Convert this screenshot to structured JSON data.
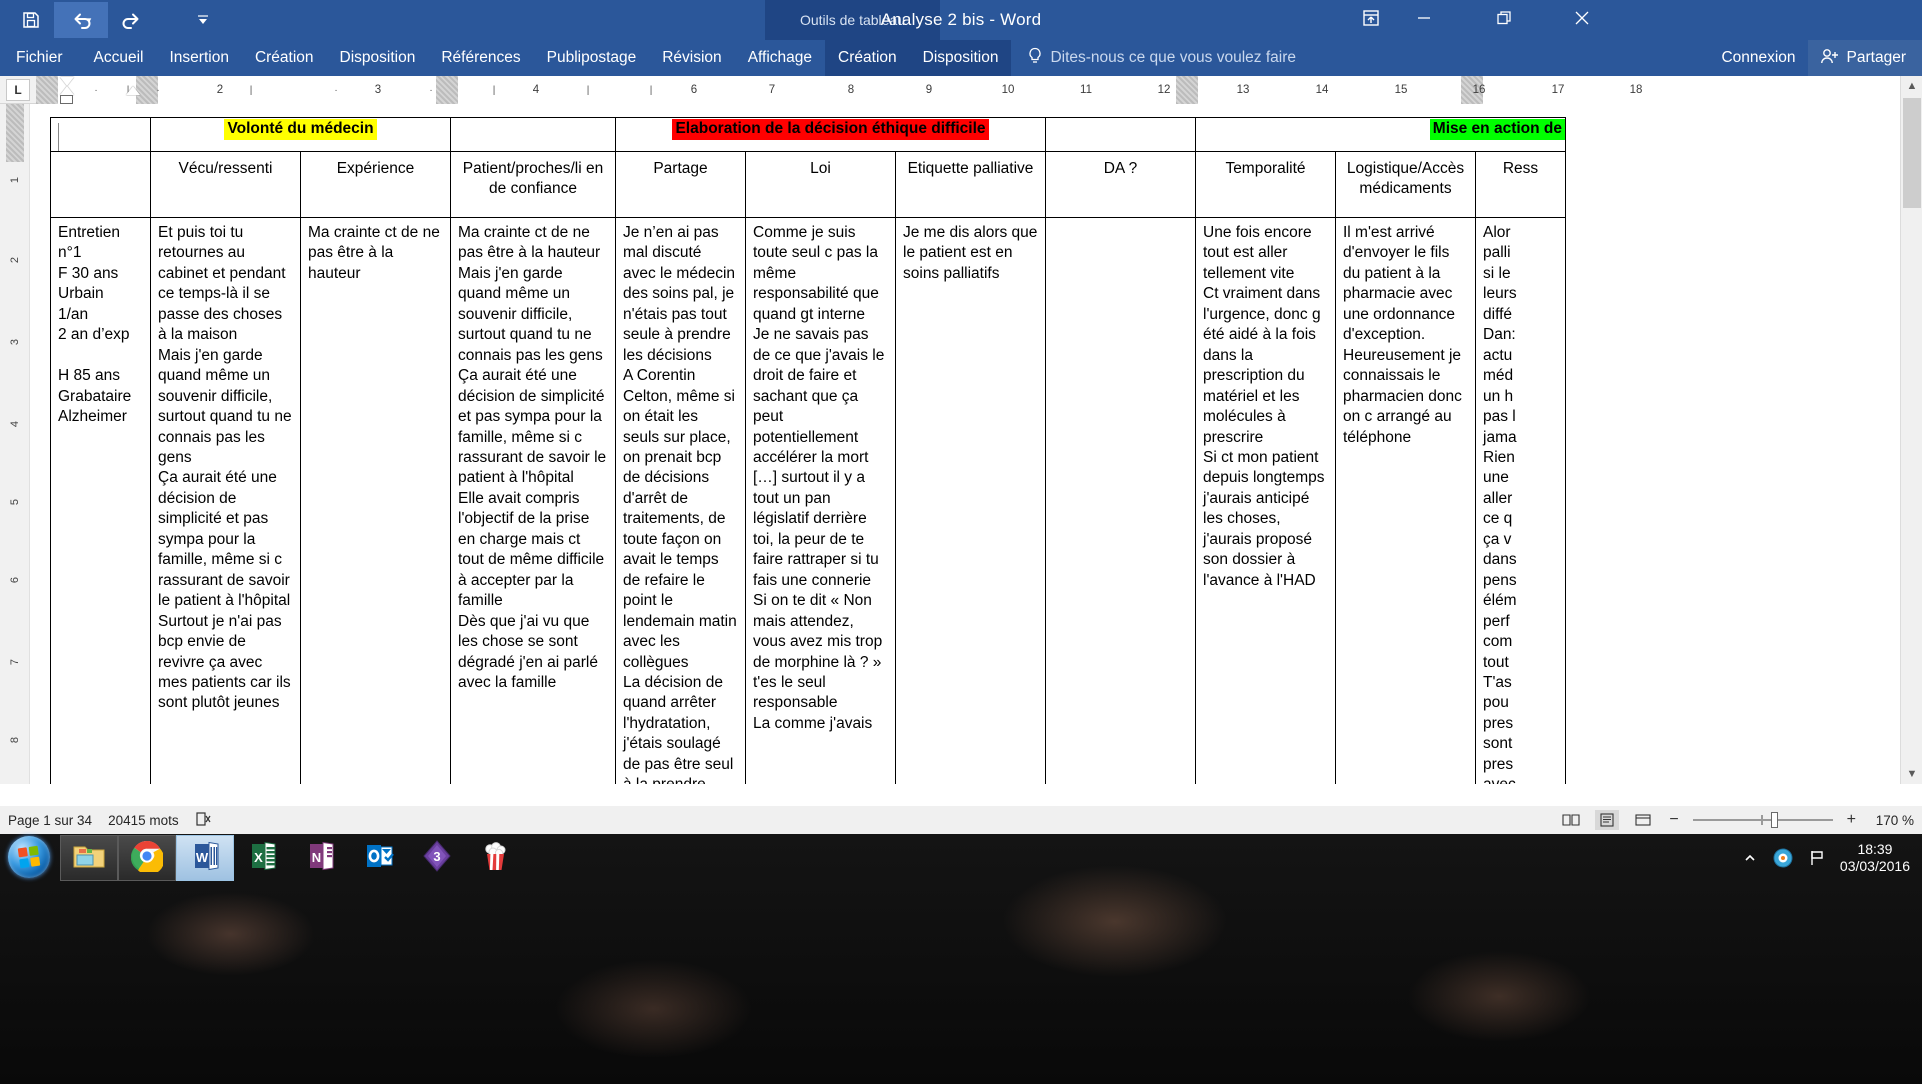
{
  "window": {
    "doc_title": "Analyse 2 bis - Word",
    "contextual_tab_group": "Outils de tableau",
    "quick_access": {
      "save": "save-icon",
      "undo": "undo-icon",
      "redo": "redo-icon",
      "customize": "customize-quick-access-icon"
    },
    "controls": {
      "ribbon_display": "ribbon-display-options-icon",
      "minimize": "minimize-icon",
      "restore": "restore-icon",
      "close": "close-icon"
    }
  },
  "ribbon": {
    "tabs": [
      "Fichier",
      "Accueil",
      "Insertion",
      "Création",
      "Disposition",
      "Références",
      "Publipostage",
      "Révision",
      "Affichage"
    ],
    "contextual_tabs": [
      "Création",
      "Disposition"
    ],
    "tell_me": "Dites-nous ce que vous voulez faire",
    "connexion": "Connexion",
    "partager": "Partager"
  },
  "ruler": {
    "tab_stop_type": "L",
    "major_ticks": [
      "2",
      "3",
      "4",
      "6",
      "7",
      "8",
      "9",
      "10",
      "11",
      "12",
      "13",
      "14",
      "15",
      "16",
      "17",
      "18"
    ],
    "vertical_ticks": [
      "1",
      "2",
      "3",
      "4",
      "5",
      "6",
      "7",
      "8"
    ]
  },
  "table": {
    "group_headers": [
      {
        "label": "Volonté du médecin",
        "highlight": "#ffff00"
      },
      {
        "label": "Elaboration de la décision éthique difficile",
        "highlight": "#ff0000"
      },
      {
        "label": "Mise en action de",
        "highlight": "#00ff00"
      }
    ],
    "columns": [
      "",
      "Vécu/ressenti",
      "Expérience",
      "Patient/proches/li en de confiance",
      "Partage",
      "Loi",
      "Etiquette palliative",
      "DA ?",
      "Temporalité",
      "Logistique/Accès médicaments",
      "Ress"
    ],
    "row": {
      "meta": "Entretien n°1\nF 30 ans\nUrbain\n1/an\n2 an d’exp\n\nH 85 ans\nGrabataire\nAlzheimer",
      "vecu_ressenti": "Et puis toi tu retournes au cabinet et pendant ce temps-là il se passe des choses à la maison\nMais j'en garde quand même un souvenir difficile, surtout quand tu ne connais pas les gens\nÇa aurait été une décision de simplicité et pas sympa pour la famille, même si c rassurant de savoir le patient à l'hôpital\nSurtout je n'ai pas bcp envie de revivre ça avec mes patients car ils sont plutôt jeunes",
      "experience": "Ma crainte ct de ne pas être à la hauteur",
      "patient_proches": "Ma crainte ct de ne pas être à la hauteur\nMais j'en garde quand même un souvenir difficile, surtout quand tu ne connais pas les gens\nÇa aurait été une décision de simplicité et pas sympa pour la famille, même si c rassurant de savoir le patient à l'hôpital\nElle avait compris l'objectif de la prise en charge mais ct tout de même difficile à accepter par la famille\nDès que j'ai vu que les chose se sont dégradé j'en ai parlé avec la famille",
      "partage": "Je n’en ai pas mal discuté avec le médecin des soins pal, je n'étais pas tout seule à prendre les décisions\nA Corentin Celton, même si on était les seuls sur place, on prenait bcp de décisions d'arrêt de traitements, de toute façon on avait le temps de refaire le point le lendemain matin avec les collègues\nLa décision de quand arrêter l'hydratation, j'étais soulagé de pas être seul à la prendre",
      "loi": "Comme je suis toute seul c pas la même responsabilité que quand gt interne\nJe ne savais pas de ce que j'avais le droit de faire et sachant que ça peut potentiellement accélérer la mort […] surtout il y a tout un pan législatif derrière toi, la peur de te faire rattraper si tu fais une connerie\nSi on te dit « Non mais attendez, vous avez mis trop de morphine là ? » t'es le seul responsable\nLa comme j'avais",
      "etiquette_palliative": "Je me dis alors que le patient est en soins palliatifs",
      "da": "",
      "temporalite": "Une fois encore tout est aller tellement vite\nCt vraiment dans l'urgence, donc g été aidé à la fois dans la prescription du matériel et les molécules à prescrire\nSi ct mon patient depuis longtemps j'aurais anticipé les choses, j'aurais proposé son dossier à l'avance à l'HAD",
      "logistique": "Il m'est arrivé d'envoyer le fils du patient à la pharmacie avec une ordonnance d'exception. Heureusement je connaissais le pharmacien donc on c arrangé au téléphone",
      "ressources": "Alor\npalli\nsi le\nleurs\ndiffé\nDan:\nactu\nméd\nun h\npas l\njama\nRien\nune \naller\nce q\nça v\ndans\npens\nélém\nperf\ncom\ntout\nT'as\npou\npres\nsont\npres\navec"
    }
  },
  "status_bar": {
    "page": "Page 1 sur 34",
    "words": "20415 mots",
    "proofing_icon": "proofing-errors-icon",
    "views": [
      "read-mode-icon",
      "print-layout-icon",
      "web-layout-icon"
    ],
    "zoom_out": "−",
    "zoom_in": "+",
    "zoom_level": "170 %"
  },
  "taskbar": {
    "start": "windows-start-orb",
    "items": [
      {
        "name": "file-explorer",
        "label": "Explorateur de fichiers"
      },
      {
        "name": "google-chrome",
        "label": "Google Chrome"
      },
      {
        "name": "microsoft-word",
        "label": "Word"
      },
      {
        "name": "microsoft-excel",
        "label": "Excel"
      },
      {
        "name": "microsoft-onenote",
        "label": "OneNote"
      },
      {
        "name": "microsoft-outlook",
        "label": "Outlook"
      },
      {
        "name": "purple-diamond-app",
        "label": "3"
      },
      {
        "name": "popcorn-time",
        "label": "Popcorn Time"
      }
    ],
    "tray": {
      "show_hidden": "show-hidden-icons-icon",
      "antivirus": "antivirus-icon",
      "flag": "action-center-flag-icon",
      "time": "18:39",
      "date": "03/03/2016"
    }
  },
  "colors": {
    "word_blue": "#2b579a",
    "contextual_dark": "#1f4584",
    "highlight_yellow": "#ffff00",
    "highlight_red": "#ff0000",
    "highlight_green": "#00ff00"
  }
}
